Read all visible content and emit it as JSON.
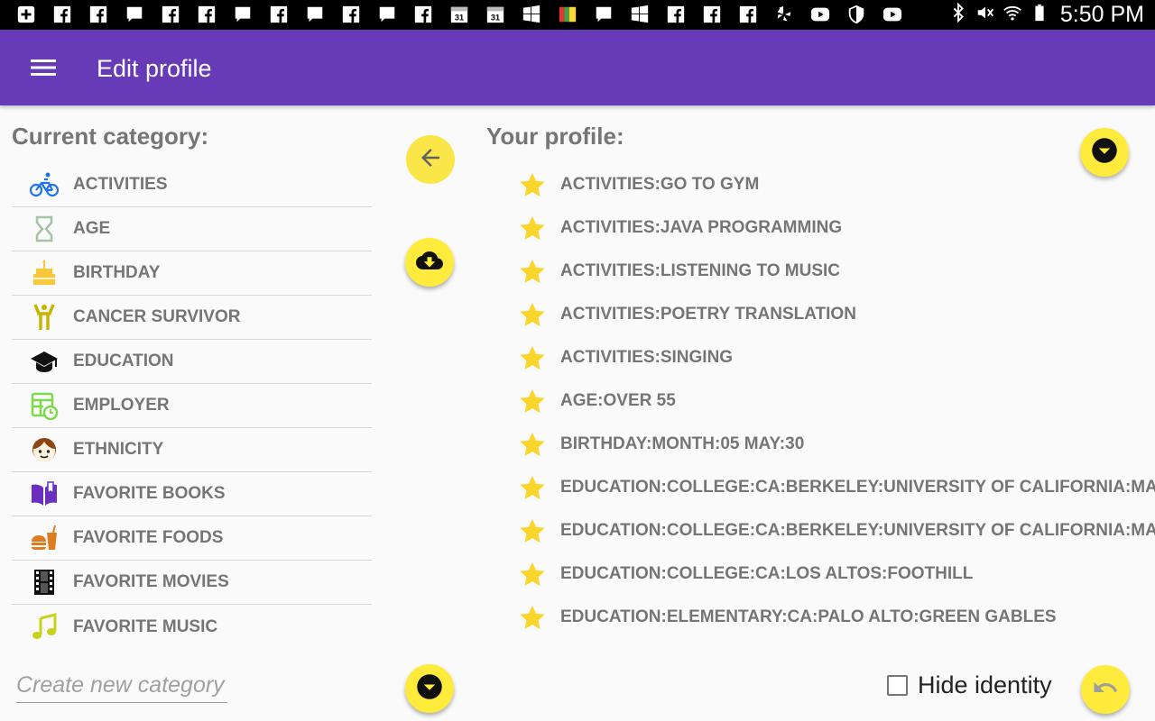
{
  "status_bar": {
    "time": "5:50 PM",
    "notification_icons": [
      "plus-box-icon",
      "facebook-icon",
      "facebook-icon",
      "message-icon",
      "facebook-icon",
      "facebook-icon",
      "message-icon",
      "facebook-icon",
      "message-icon",
      "facebook-icon",
      "message-icon",
      "facebook-icon",
      "calendar-icon",
      "calendar-icon",
      "windows-icon",
      "avg-icon",
      "message-icon",
      "windows-icon",
      "facebook-icon",
      "facebook-icon",
      "facebook-icon",
      "yelp-icon",
      "youtube-icon",
      "shield-icon",
      "youtube-icon"
    ],
    "calendar_day": "31",
    "system_icons": [
      "bluetooth-icon",
      "mute-icon",
      "wifi-icon",
      "battery-icon"
    ]
  },
  "app_bar": {
    "title": "Edit profile",
    "color": "#673ab7"
  },
  "left_panel": {
    "title": "Current category:",
    "categories": [
      {
        "label": "ACTIVITIES",
        "icon": "bicycle-icon",
        "color": "#1e73e8"
      },
      {
        "label": "AGE",
        "icon": "hourglass-icon",
        "color": "#a5c3a5"
      },
      {
        "label": "BIRTHDAY",
        "icon": "cake-icon",
        "color": "#f9c838"
      },
      {
        "label": "CANCER SURVIVOR",
        "icon": "person-arms-up-icon",
        "color": "#c8b400"
      },
      {
        "label": "EDUCATION",
        "icon": "graduation-cap-icon",
        "color": "#111111"
      },
      {
        "label": "EMPLOYER",
        "icon": "timesheet-icon",
        "color": "#7dd94a"
      },
      {
        "label": "ETHNICITY",
        "icon": "face-icon",
        "color": "#8b4513"
      },
      {
        "label": "FAVORITE BOOKS",
        "icon": "book-icon",
        "color": "#6b2fbf"
      },
      {
        "label": "FAVORITE FOODS",
        "icon": "fast-food-icon",
        "color": "#e07b20"
      },
      {
        "label": "FAVORITE MOVIES",
        "icon": "film-icon",
        "color": "#111111"
      },
      {
        "label": "FAVORITE MUSIC",
        "icon": "music-note-icon",
        "color": "#c9d21b"
      }
    ],
    "new_category_placeholder": "Create new category"
  },
  "right_panel": {
    "title": "Your profile:",
    "items": [
      "ACTIVITIES:GO TO GYM",
      "ACTIVITIES:JAVA PROGRAMMING",
      "ACTIVITIES:LISTENING TO MUSIC",
      "ACTIVITIES:POETRY TRANSLATION",
      "ACTIVITIES:SINGING",
      "AGE:OVER 55",
      "BIRTHDAY:MONTH:05 MAY:30",
      "EDUCATION:COLLEGE:CA:BERKELEY:UNIVERSITY OF CALIFORNIA:MATHEMA",
      "EDUCATION:COLLEGE:CA:BERKELEY:UNIVERSITY OF CALIFORNIA:MATHEMA",
      "EDUCATION:COLLEGE:CA:LOS ALTOS:FOOTHILL",
      "EDUCATION:ELEMENTARY:CA:PALO ALTO:GREEN GABLES"
    ],
    "hide_identity_label": "Hide identity",
    "hide_identity_checked": false
  },
  "colors": {
    "fab": "#ffeb3b",
    "star": "#fbd52b",
    "text_gray": "#757575"
  }
}
